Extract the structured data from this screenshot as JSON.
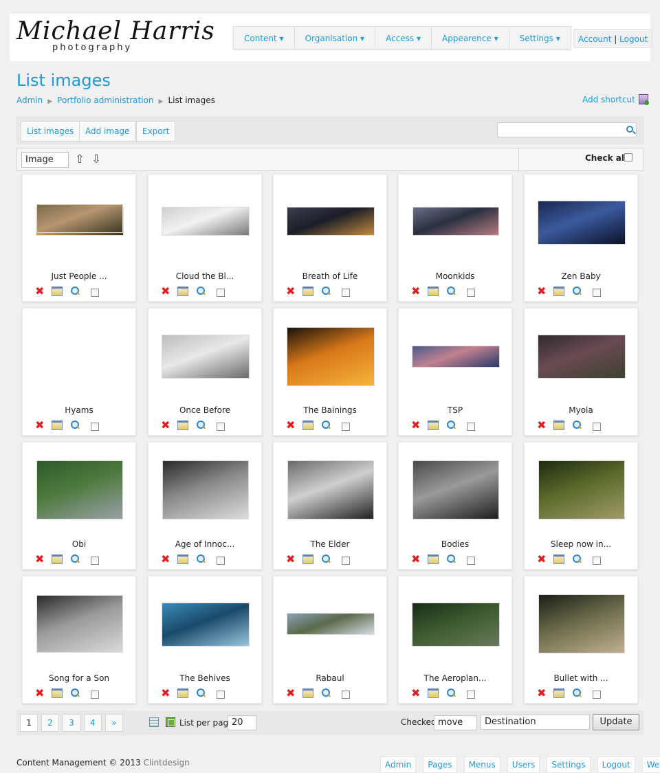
{
  "header": {
    "logo_name": "Michael Harris",
    "logo_sub": "photography",
    "nav": [
      "Content ▾",
      "Organisation ▾",
      "Access ▾",
      "Appearence ▾",
      "Settings ▾"
    ],
    "account_label": "Account",
    "account_sep": "|",
    "logout_label": "Logout"
  },
  "page": {
    "title": "List images",
    "breadcrumb": [
      "Admin",
      "Portfolio administration",
      "List images"
    ],
    "shortcut_label": "Add shortcut"
  },
  "toolbar": {
    "buttons": [
      "List images",
      "Add image",
      "Export"
    ],
    "search_value": ""
  },
  "sortbar": {
    "sort_field": "Image",
    "up_arrow": "⇧",
    "down_arrow": "⇩",
    "check_all_label": "Check all"
  },
  "images": [
    {
      "title": "Just People ...",
      "colors": [
        "#6b5a2e",
        "#c9a25a",
        "#3c3418"
      ]
    },
    {
      "title": "Cloud the Bl...",
      "colors": [
        "#cfcfcf",
        "#f2f2f2",
        "#7a7a7a"
      ]
    },
    {
      "title": "Breath of Life",
      "colors": [
        "#3a3f4c",
        "#1b1e28",
        "#c58a3a"
      ]
    },
    {
      "title": "Moonkids",
      "colors": [
        "#6a6f86",
        "#2a3040",
        "#b77c7f"
      ]
    },
    {
      "title": "Zen Baby",
      "colors": [
        "#1a2750",
        "#3b5a9e",
        "#0c1228"
      ]
    },
    {
      "title": "Hyams",
      "colors": [
        "#7a6a4a",
        "#b89570",
        "#3a3a22"
      ]
    },
    {
      "title": "Once Before",
      "colors": [
        "#bdbdbd",
        "#e8e8e8",
        "#6a6a6a"
      ]
    },
    {
      "title": "The Bainings",
      "colors": [
        "#1a120a",
        "#d8781a",
        "#f6b43a"
      ]
    },
    {
      "title": "TSP",
      "colors": [
        "#4b5a8a",
        "#c28190",
        "#2a3a6a"
      ]
    },
    {
      "title": "Myola",
      "colors": [
        "#2e2a2e",
        "#6a4a52",
        "#3c4230"
      ]
    },
    {
      "title": "Obi",
      "colors": [
        "#2f5a2a",
        "#4e7a3e",
        "#9aa0a8"
      ]
    },
    {
      "title": "Age of Innoc...",
      "colors": [
        "#2a2a2a",
        "#8a8a8a",
        "#dcdcdc"
      ]
    },
    {
      "title": "The Elder",
      "colors": [
        "#6a6a6a",
        "#cfcfcf",
        "#222222"
      ]
    },
    {
      "title": "Bodies",
      "colors": [
        "#4a4a4a",
        "#9a9a9a",
        "#1e1e1e"
      ]
    },
    {
      "title": "Sleep now in...",
      "colors": [
        "#1e2a12",
        "#5a6a2a",
        "#a09a6a"
      ]
    },
    {
      "title": "Song for a Son",
      "colors": [
        "#2a2a2a",
        "#9a9a9a",
        "#dadada"
      ]
    },
    {
      "title": "The Behives",
      "colors": [
        "#3a8ab8",
        "#1a4a6a",
        "#9ac4dc"
      ]
    },
    {
      "title": "Rabaul",
      "colors": [
        "#8aa0b4",
        "#5a6a4a",
        "#d4dce4"
      ]
    },
    {
      "title": "The Aeroplan...",
      "colors": [
        "#1a2a18",
        "#3a5a2e",
        "#6a7a5a"
      ]
    },
    {
      "title": "Bullet with ...",
      "colors": [
        "#1a1e16",
        "#6a6a4a",
        "#c0b090"
      ]
    }
  ],
  "pager": {
    "pages": [
      "1",
      "2",
      "3",
      "4",
      "»"
    ],
    "current_page": "1",
    "list_per_page_label": "List per page",
    "list_per_page_value": "20",
    "checked_label": "Checked",
    "action_value": "move",
    "destination_value": "Destination",
    "update_label": "Update"
  },
  "footer": {
    "text": "Content Management © 2013",
    "brand": "Clintdesign",
    "links": [
      "Admin",
      "Pages",
      "Menus",
      "Users",
      "Settings",
      "Logout",
      "Website"
    ]
  }
}
